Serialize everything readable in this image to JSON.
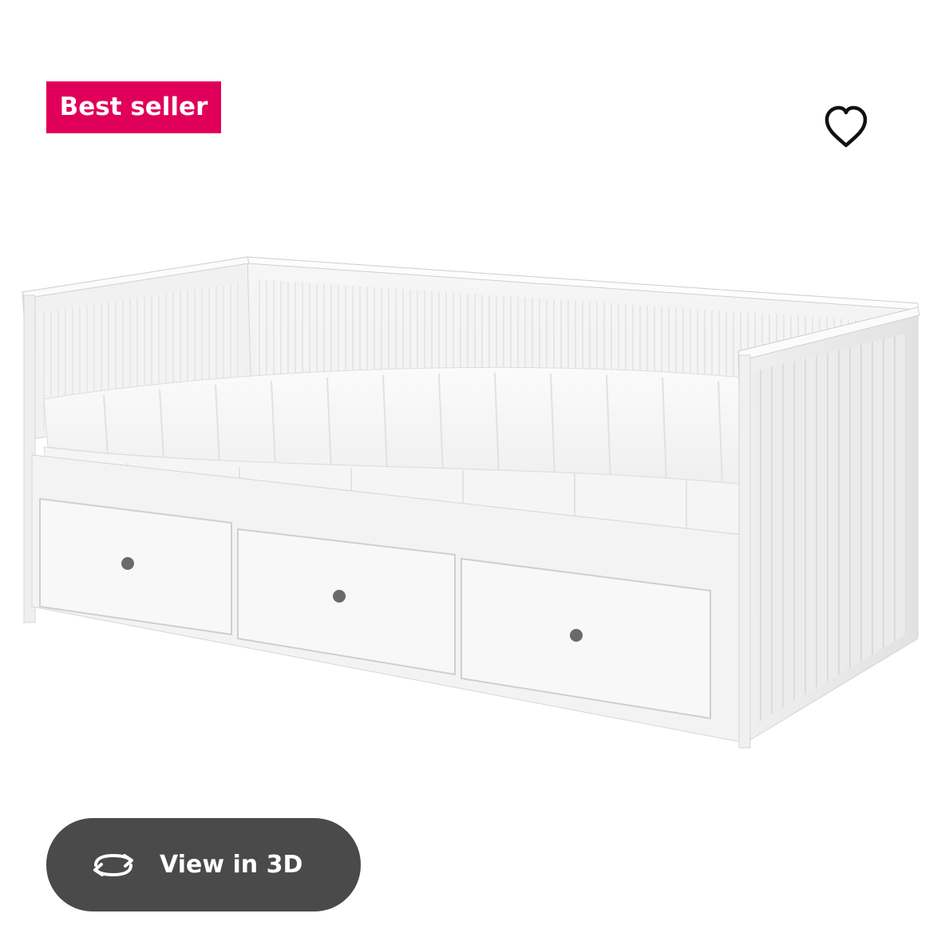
{
  "badge": {
    "label": "Best seller",
    "color": "#e0005a"
  },
  "favorite": {
    "icon": "heart-outline-icon"
  },
  "product_image": {
    "subject": "white daybed with three drawers and mattress"
  },
  "view_3d": {
    "label": "View in 3D",
    "icon": "rotate-arrows-icon",
    "background": "#4a4a4a"
  }
}
